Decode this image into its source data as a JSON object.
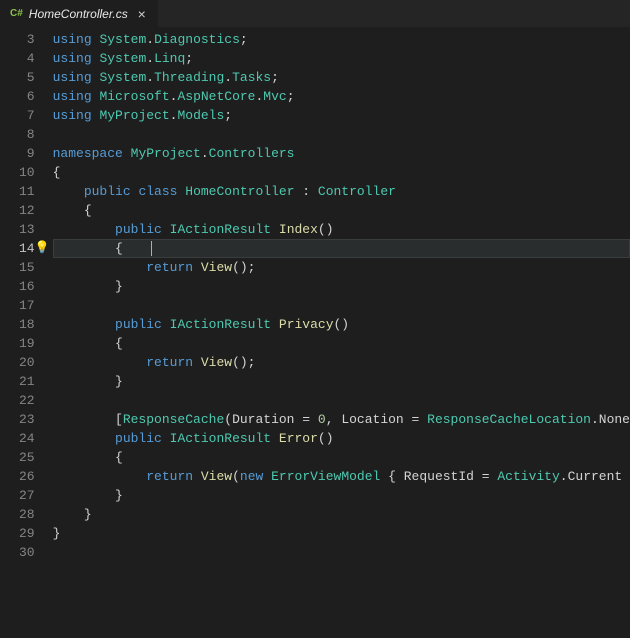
{
  "tab": {
    "lang_badge": "C#",
    "title": "HomeController.cs",
    "close": "×"
  },
  "editor": {
    "first_line_number": 3,
    "current_line_number": 14,
    "lightbulb_line": 14,
    "lines": [
      [
        [
          "kw",
          "using"
        ],
        [
          "punc",
          " "
        ],
        [
          "cls",
          "System"
        ],
        [
          "punc",
          "."
        ],
        [
          "cls",
          "Diagnostics"
        ],
        [
          "punc",
          ";"
        ]
      ],
      [
        [
          "kw",
          "using"
        ],
        [
          "punc",
          " "
        ],
        [
          "cls",
          "System"
        ],
        [
          "punc",
          "."
        ],
        [
          "cls",
          "Linq"
        ],
        [
          "punc",
          ";"
        ]
      ],
      [
        [
          "kw",
          "using"
        ],
        [
          "punc",
          " "
        ],
        [
          "cls",
          "System"
        ],
        [
          "punc",
          "."
        ],
        [
          "cls",
          "Threading"
        ],
        [
          "punc",
          "."
        ],
        [
          "cls",
          "Tasks"
        ],
        [
          "punc",
          ";"
        ]
      ],
      [
        [
          "kw",
          "using"
        ],
        [
          "punc",
          " "
        ],
        [
          "cls",
          "Microsoft"
        ],
        [
          "punc",
          "."
        ],
        [
          "cls",
          "AspNetCore"
        ],
        [
          "punc",
          "."
        ],
        [
          "cls",
          "Mvc"
        ],
        [
          "punc",
          ";"
        ]
      ],
      [
        [
          "kw",
          "using"
        ],
        [
          "punc",
          " "
        ],
        [
          "cls",
          "MyProject"
        ],
        [
          "punc",
          "."
        ],
        [
          "cls",
          "Models"
        ],
        [
          "punc",
          ";"
        ]
      ],
      [],
      [
        [
          "kw",
          "namespace"
        ],
        [
          "punc",
          " "
        ],
        [
          "cls",
          "MyProject"
        ],
        [
          "punc",
          "."
        ],
        [
          "cls",
          "Controllers"
        ]
      ],
      [
        [
          "punc",
          "{"
        ]
      ],
      [
        [
          "punc",
          "    "
        ],
        [
          "kw",
          "public"
        ],
        [
          "punc",
          " "
        ],
        [
          "kw",
          "class"
        ],
        [
          "punc",
          " "
        ],
        [
          "cls",
          "HomeController"
        ],
        [
          "punc",
          " : "
        ],
        [
          "cls",
          "Controller"
        ]
      ],
      [
        [
          "punc",
          "    {"
        ]
      ],
      [
        [
          "punc",
          "        "
        ],
        [
          "kw",
          "public"
        ],
        [
          "punc",
          " "
        ],
        [
          "cls",
          "IActionResult"
        ],
        [
          "punc",
          " "
        ],
        [
          "mth",
          "Index"
        ],
        [
          "punc",
          "()"
        ]
      ],
      [
        [
          "punc",
          "        {"
        ]
      ],
      [
        [
          "punc",
          "            "
        ],
        [
          "kw",
          "return"
        ],
        [
          "punc",
          " "
        ],
        [
          "mth",
          "View"
        ],
        [
          "punc",
          "();"
        ]
      ],
      [
        [
          "punc",
          "        }"
        ]
      ],
      [],
      [
        [
          "punc",
          "        "
        ],
        [
          "kw",
          "public"
        ],
        [
          "punc",
          " "
        ],
        [
          "cls",
          "IActionResult"
        ],
        [
          "punc",
          " "
        ],
        [
          "mth",
          "Privacy"
        ],
        [
          "punc",
          "()"
        ]
      ],
      [
        [
          "punc",
          "        {"
        ]
      ],
      [
        [
          "punc",
          "            "
        ],
        [
          "kw",
          "return"
        ],
        [
          "punc",
          " "
        ],
        [
          "mth",
          "View"
        ],
        [
          "punc",
          "();"
        ]
      ],
      [
        [
          "punc",
          "        }"
        ]
      ],
      [],
      [
        [
          "punc",
          "        ["
        ],
        [
          "cls",
          "ResponseCache"
        ],
        [
          "punc",
          "("
        ],
        [
          "prop",
          "Duration"
        ],
        [
          "punc",
          " = "
        ],
        [
          "num",
          "0"
        ],
        [
          "punc",
          ", "
        ],
        [
          "prop",
          "Location"
        ],
        [
          "punc",
          " = "
        ],
        [
          "cls",
          "ResponseCacheLocation"
        ],
        [
          "punc",
          "."
        ],
        [
          "prop",
          "None"
        ]
      ],
      [
        [
          "punc",
          "        "
        ],
        [
          "kw",
          "public"
        ],
        [
          "punc",
          " "
        ],
        [
          "cls",
          "IActionResult"
        ],
        [
          "punc",
          " "
        ],
        [
          "mth",
          "Error"
        ],
        [
          "punc",
          "()"
        ]
      ],
      [
        [
          "punc",
          "        {"
        ]
      ],
      [
        [
          "punc",
          "            "
        ],
        [
          "kw",
          "return"
        ],
        [
          "punc",
          " "
        ],
        [
          "mth",
          "View"
        ],
        [
          "punc",
          "("
        ],
        [
          "kw",
          "new"
        ],
        [
          "punc",
          " "
        ],
        [
          "cls",
          "ErrorViewModel"
        ],
        [
          "punc",
          " { "
        ],
        [
          "prop",
          "RequestId"
        ],
        [
          "punc",
          " = "
        ],
        [
          "cls",
          "Activity"
        ],
        [
          "punc",
          "."
        ],
        [
          "prop",
          "Current"
        ]
      ],
      [
        [
          "punc",
          "        }"
        ]
      ],
      [
        [
          "punc",
          "    }"
        ]
      ],
      [
        [
          "punc",
          "}"
        ]
      ],
      []
    ]
  }
}
